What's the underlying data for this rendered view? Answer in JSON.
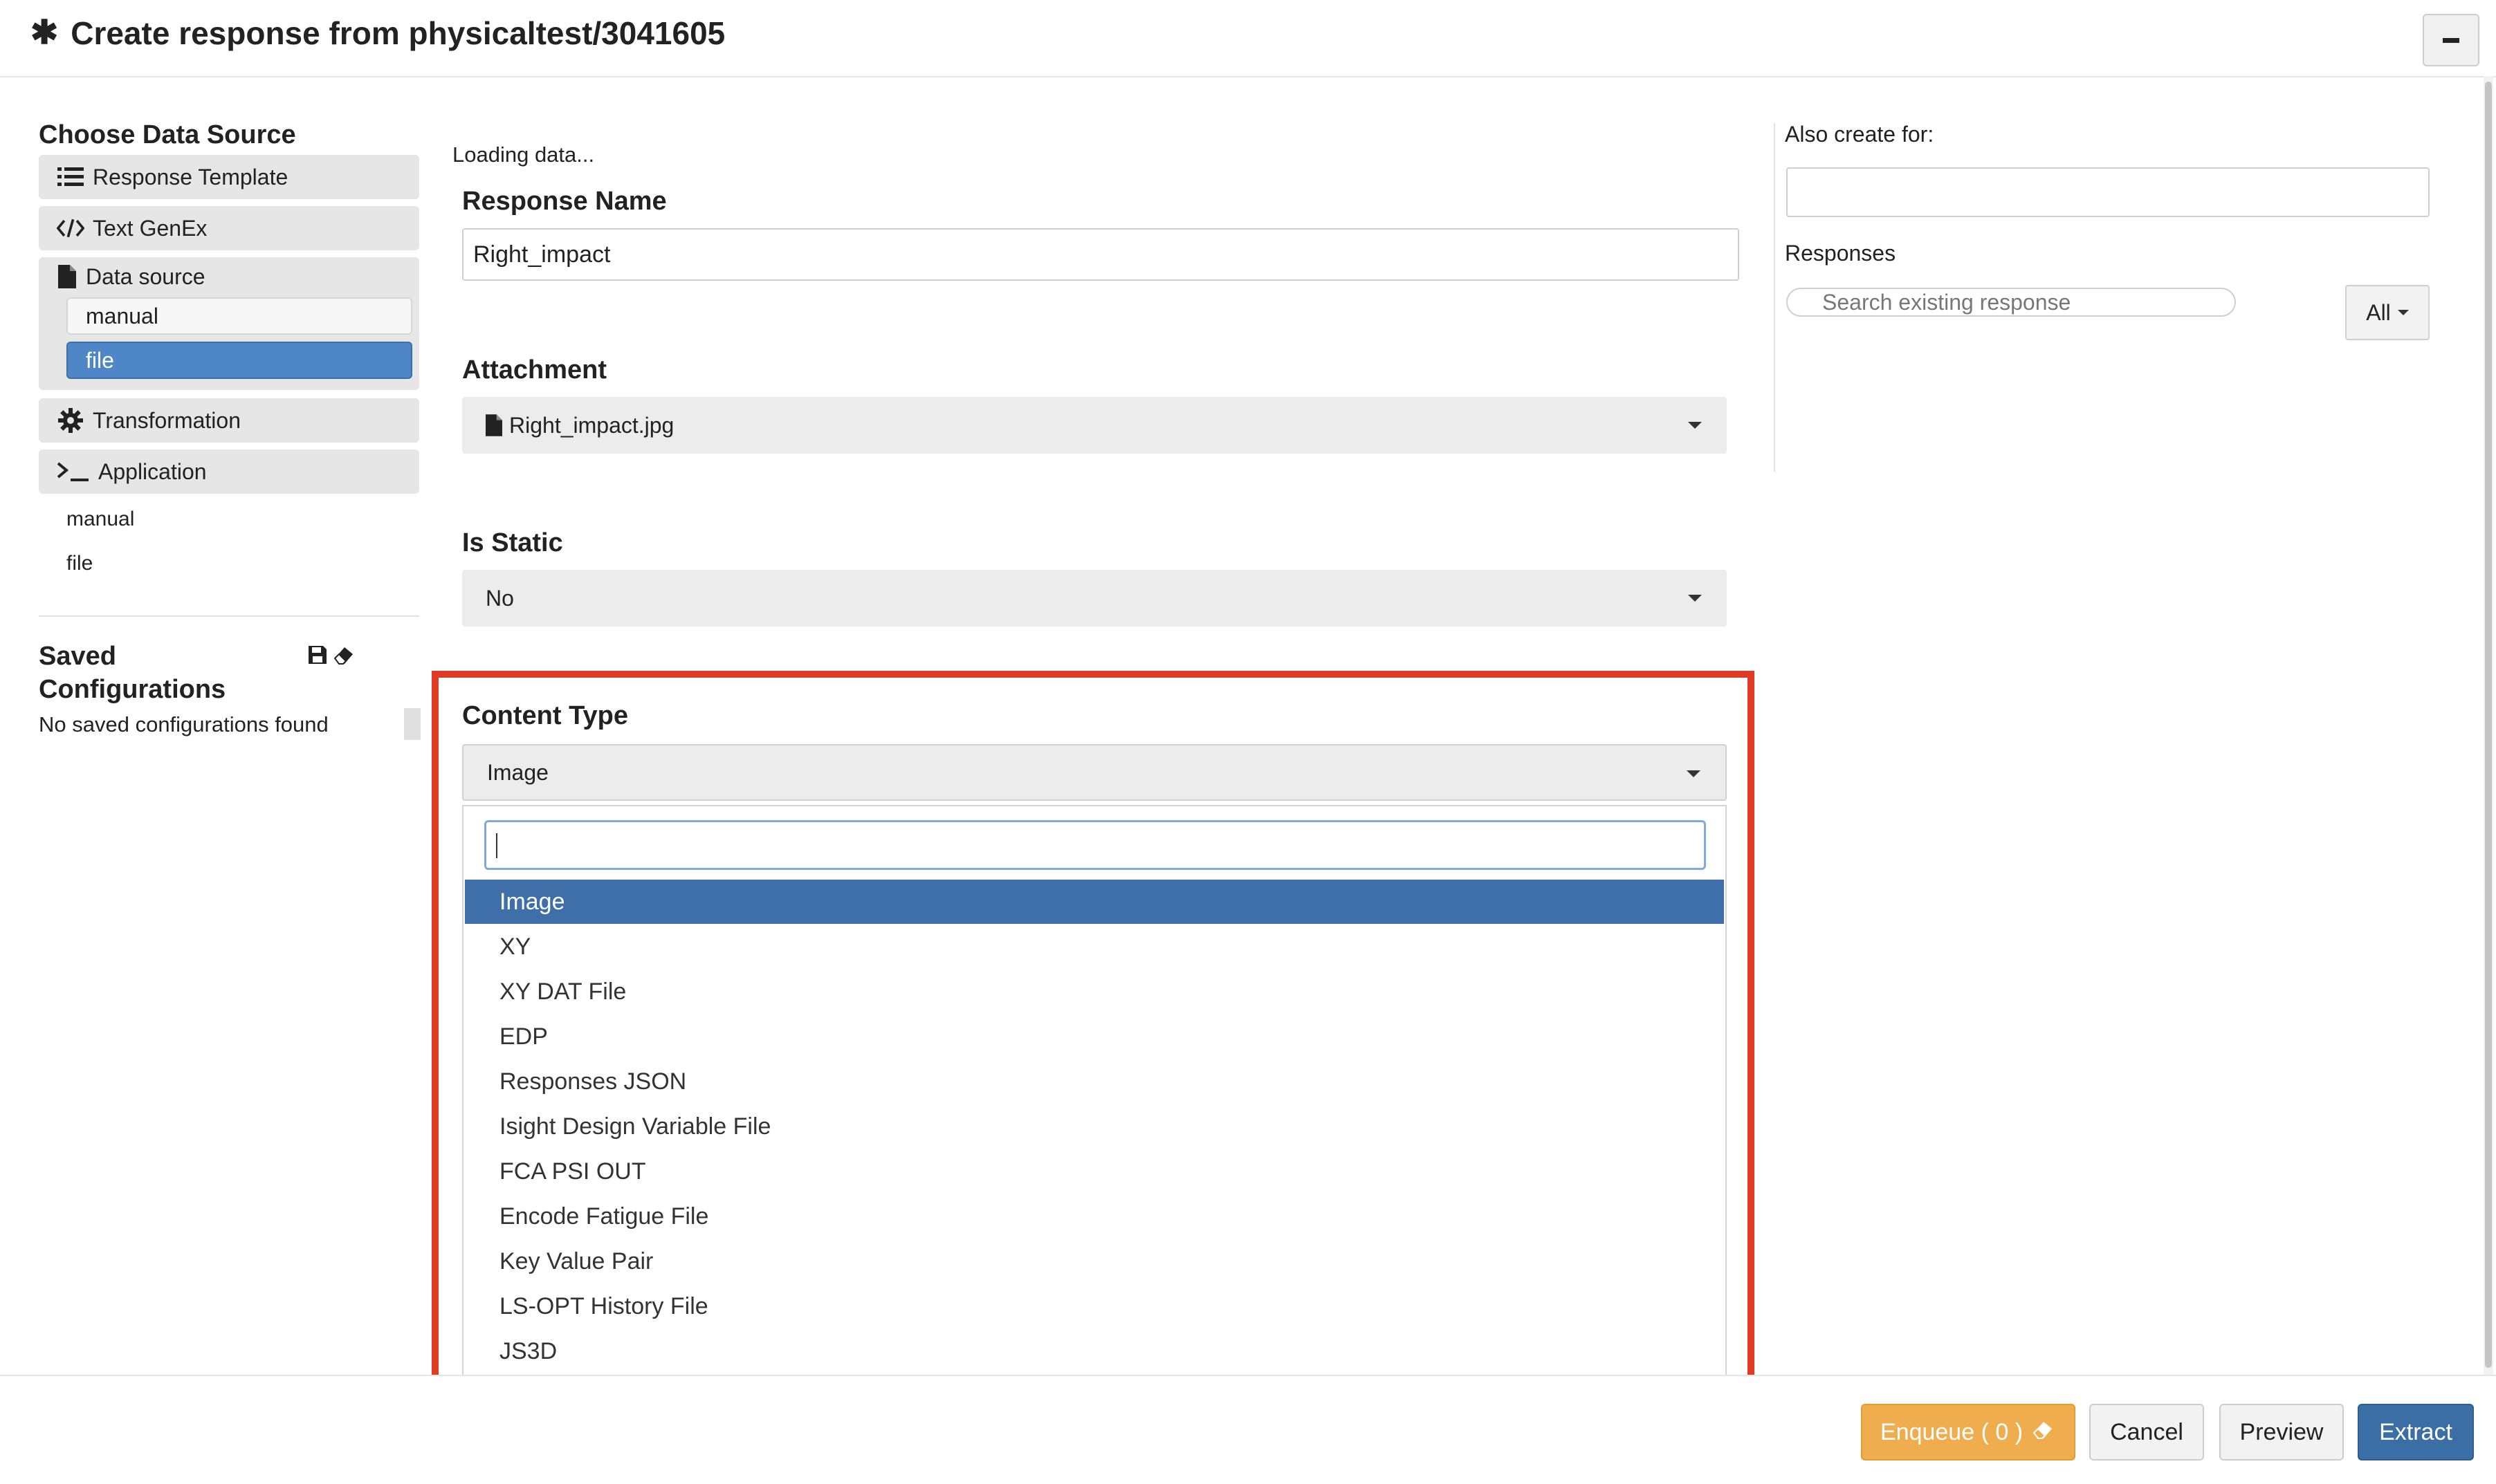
{
  "header": {
    "title": "Create response from physicaltest/3041605"
  },
  "sidebar": {
    "section_title": "Choose Data Source",
    "items": {
      "response_template": "Response Template",
      "text_genex": "Text GenEx",
      "data_source": "Data source",
      "transformation": "Transformation",
      "application": "Application"
    },
    "data_source_sub": [
      "manual",
      "file"
    ],
    "selected_sub": "file",
    "extra_list": [
      "manual",
      "file"
    ],
    "saved_title_line1": "Saved",
    "saved_title_line2": "Configurations",
    "saved_empty": "No saved configurations found"
  },
  "form": {
    "loading": "Loading data...",
    "response_name_label": "Response Name",
    "response_name_value": "Right_impact",
    "attachment_label": "Attachment",
    "attachment_value": "Right_impact.jpg",
    "is_static_label": "Is Static",
    "is_static_value": "No",
    "content_type_label": "Content Type",
    "content_type_value": "Image",
    "options": [
      "Image",
      "XY",
      "XY DAT File",
      "EDP",
      "Responses JSON",
      "Isight Design Variable File",
      "FCA PSI OUT",
      "Encode Fatigue File",
      "Key Value Pair",
      "LS-OPT History File",
      "JS3D"
    ],
    "selected_option": "Image"
  },
  "right_panel": {
    "also_create_label": "Also create for:",
    "also_create_value": "",
    "responses_label": "Responses",
    "search_placeholder": "Search existing response",
    "filter_value": "All"
  },
  "footer": {
    "enqueue_label": "Enqueue ( 0 )",
    "cancel_label": "Cancel",
    "preview_label": "Preview",
    "extract_label": "Extract"
  },
  "colors": {
    "selected_blue": "#4f86c8",
    "option_selected": "#3f6fa9",
    "enqueue_orange": "#f0ad4e",
    "extract_blue": "#3a6ea5",
    "highlight_red": "#e03b24"
  }
}
